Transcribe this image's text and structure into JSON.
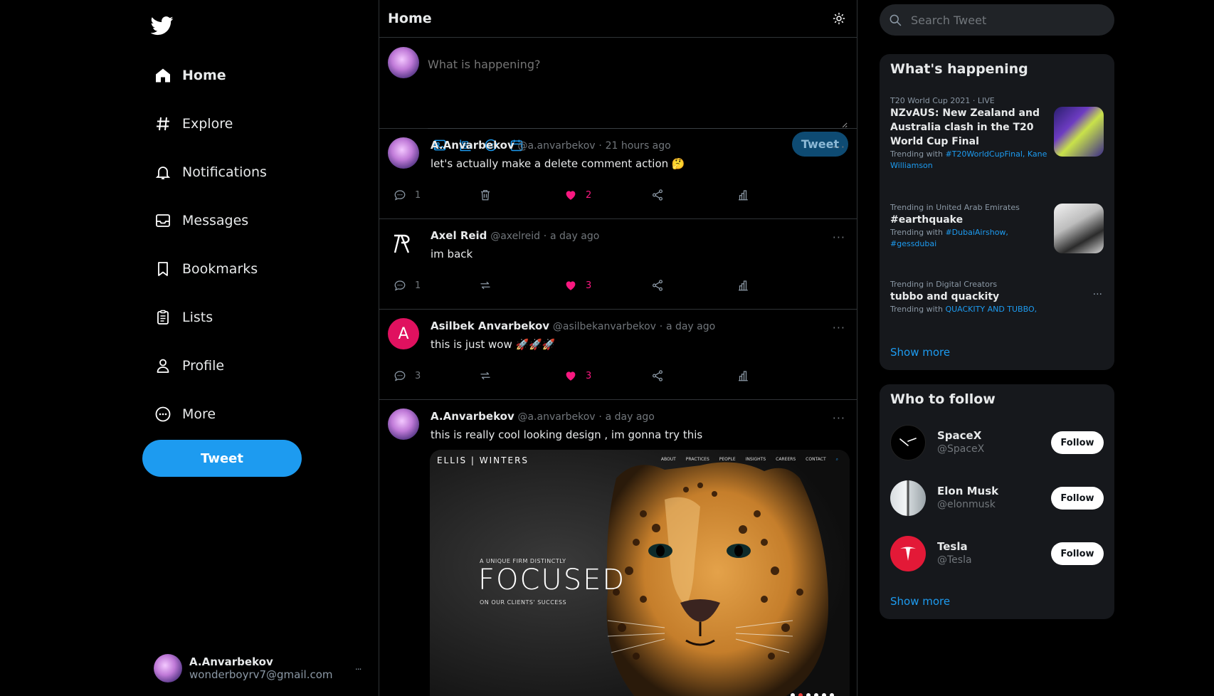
{
  "sidebar": {
    "logo": "twitter-bird-icon",
    "items": [
      {
        "label": "Home",
        "icon": "home-icon"
      },
      {
        "label": "Explore",
        "icon": "hashtag-icon"
      },
      {
        "label": "Notifications",
        "icon": "bell-icon"
      },
      {
        "label": "Messages",
        "icon": "inbox-icon"
      },
      {
        "label": "Bookmarks",
        "icon": "bookmark-icon"
      },
      {
        "label": "Lists",
        "icon": "clipboard-icon"
      },
      {
        "label": "Profile",
        "icon": "user-icon"
      },
      {
        "label": "More",
        "icon": "more-circle-icon"
      }
    ],
    "tweet_button": "Tweet",
    "account": {
      "name": "A.Anvarbekov",
      "email": "wonderboyrv7@gmail.com",
      "menu": "..."
    }
  },
  "main": {
    "title": "Home",
    "theme_icon": "sun-icon",
    "compose": {
      "placeholder": "What is happening?",
      "tools": [
        "image-icon",
        "poll-icon",
        "emoji-icon",
        "calendar-icon"
      ],
      "tweet_button": "Tweet"
    },
    "tweets": [
      {
        "name": "A.Anvarbekov",
        "handle": "@a.anvarbekov",
        "dot": "·",
        "time": "21 hours ago",
        "text": "let's actually make a delete comment action 🤔",
        "replies": "1",
        "likes": "2",
        "more": "···"
      },
      {
        "name": "Axel Reid",
        "handle": "@axelreid",
        "dot": "·",
        "time": "a day ago",
        "text": "im back",
        "replies": "1",
        "likes": "3",
        "more": "···"
      },
      {
        "name": "Asilbek Anvarbekov",
        "handle": "@asilbekanvarbekov",
        "dot": "·",
        "time": "a day ago",
        "text": "this is just wow 🚀🚀🚀",
        "avatar_letter": "A",
        "replies": "3",
        "likes": "3",
        "more": "···"
      },
      {
        "name": "A.Anvarbekov",
        "handle": "@a.anvarbekov",
        "dot": "·",
        "time": "a day ago",
        "text": "this is really cool looking design , im gonna try this",
        "more": "···",
        "image": {
          "brand": "ELLIS | WINTERS",
          "menu": [
            "ABOUT",
            "PRACTICES",
            "PEOPLE",
            "INSIGHTS",
            "CAREERS",
            "CONTACT"
          ],
          "pre": "A UNIQUE FIRM DISTINCTLY",
          "headline": "FOCUSED",
          "post": "ON OUR CLIENTS' SUCCESS"
        }
      }
    ]
  },
  "right": {
    "search_placeholder": "Search Tweet",
    "happening": {
      "title": "What's happening",
      "trends": [
        {
          "meta": "T20 World Cup 2021 · LIVE",
          "title": "NZvAUS: New Zealand and Australia clash in the T20 World Cup Final",
          "with_label": "Trending with ",
          "with_links": "#T20WorldCupFinal, Kane Williamson"
        },
        {
          "meta": "Trending in United Arab Emirates",
          "title": "#earthquake",
          "with_label": "Trending with ",
          "with_links": "#DubaiAirshow, #gessdubai"
        },
        {
          "meta": "Trending in Digital Creators",
          "title": "tubbo and quackity",
          "with_label": "Trending with ",
          "with_links": "QUACKITY AND TUBBO,",
          "more": "···"
        }
      ],
      "show_more": "Show more"
    },
    "follow": {
      "title": "Who to follow",
      "users": [
        {
          "name": "SpaceX",
          "handle": "@SpaceX",
          "button": "Follow"
        },
        {
          "name": "Elon Musk",
          "handle": "@elonmusk",
          "button": "Follow"
        },
        {
          "name": "Tesla",
          "handle": "@Tesla",
          "button": "Follow"
        }
      ],
      "show_more": "Show more"
    }
  },
  "colors": {
    "accent": "#1d9bf0",
    "like": "#f91880",
    "background": "#000000",
    "panel": "#16181c"
  }
}
